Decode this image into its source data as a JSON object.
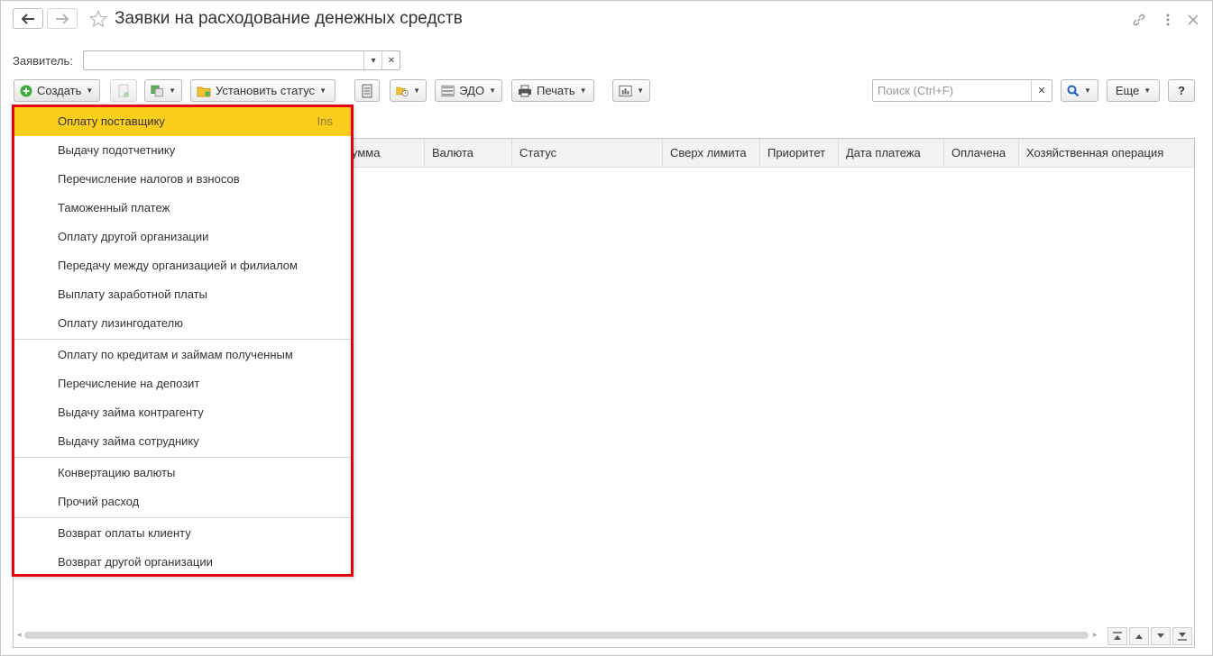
{
  "window": {
    "title": "Заявки на расходование денежных средств"
  },
  "filter": {
    "applicant_label": "Заявитель:",
    "applicant_value": ""
  },
  "toolbar": {
    "create_label": "Создать",
    "set_status_label": "Установить статус",
    "edo_label": "ЭДО",
    "print_label": "Печать",
    "search_placeholder": "Поиск (Ctrl+F)",
    "more_label": "Еще",
    "help_label": "?"
  },
  "table": {
    "columns": [
      "Сумма",
      "Валюта",
      "Статус",
      "Сверх лимита",
      "Приоритет",
      "Дата платежа",
      "Оплачена",
      "Хозяйственная операция"
    ],
    "visible_partial_first": "умма"
  },
  "create_menu": {
    "groups": [
      [
        {
          "label": "Оплату поставщику",
          "hotkey": "Ins",
          "active": true
        },
        {
          "label": "Выдачу подотчетнику"
        },
        {
          "label": "Перечисление налогов и взносов"
        },
        {
          "label": "Таможенный платеж"
        },
        {
          "label": "Оплату другой организации"
        },
        {
          "label": "Передачу между организацией и филиалом"
        },
        {
          "label": "Выплату заработной платы"
        },
        {
          "label": "Оплату лизингодателю"
        }
      ],
      [
        {
          "label": "Оплату по кредитам и займам полученным"
        },
        {
          "label": "Перечисление на депозит"
        },
        {
          "label": "Выдачу займа контрагенту"
        },
        {
          "label": "Выдачу займа сотруднику"
        }
      ],
      [
        {
          "label": "Конвертацию валюты"
        },
        {
          "label": "Прочий расход"
        }
      ],
      [
        {
          "label": "Возврат оплаты клиенту"
        },
        {
          "label": "Возврат другой организации"
        }
      ]
    ]
  },
  "colors": {
    "highlight": "#fbcd1c",
    "menu_border": "#e8000f",
    "create_icon": "#3bab3b"
  },
  "icons": [
    "back-arrow-icon",
    "forward-arrow-icon",
    "star-icon",
    "link-icon",
    "more-vertical-icon",
    "close-icon",
    "plus-circle-icon",
    "search-icon"
  ]
}
